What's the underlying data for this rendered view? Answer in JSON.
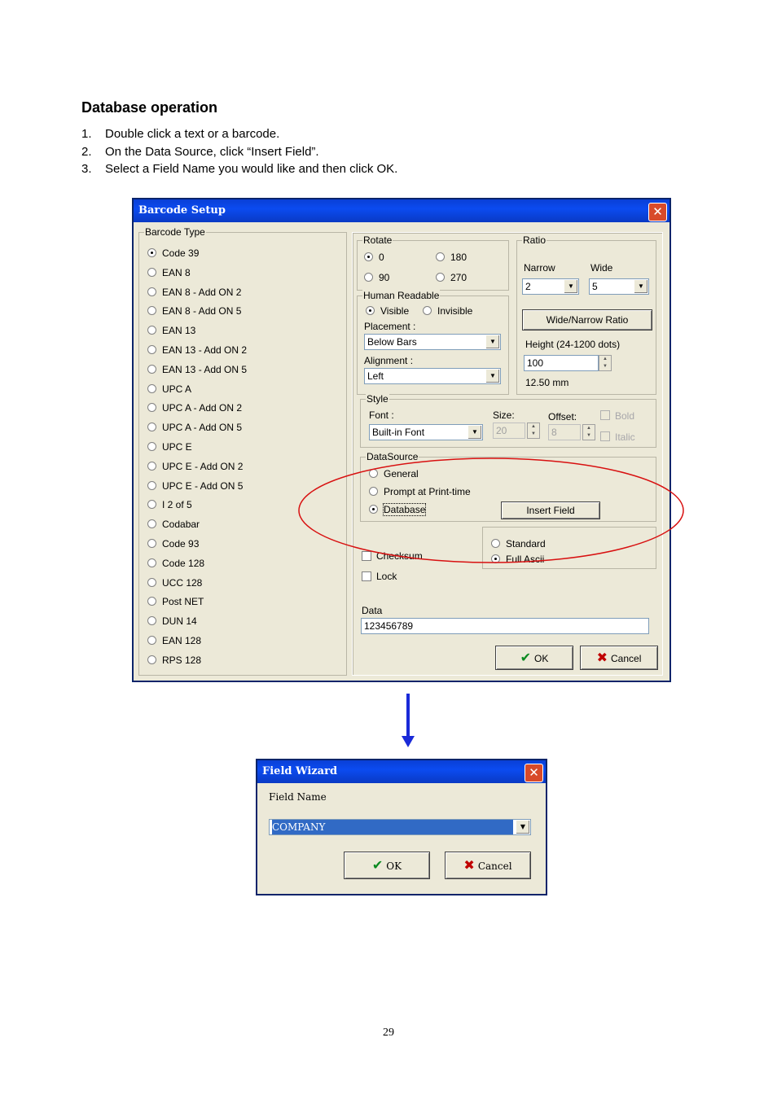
{
  "heading": "Database operation",
  "steps": [
    {
      "num": "1.",
      "text": "Double click a text or a barcode."
    },
    {
      "num": "2.",
      "text": "On the Data Source, click “Insert Field”."
    },
    {
      "num": "3.",
      "text": "Select a Field Name you would like and then click OK."
    }
  ],
  "barcode_setup": {
    "title": "Barcode Setup",
    "barcode_type_label": "Barcode Type",
    "barcode_types": [
      "Code 39",
      "EAN 8",
      "EAN 8 - Add ON 2",
      "EAN 8 - Add ON 5",
      "EAN 13",
      "EAN 13 - Add ON 2",
      "EAN 13 - Add ON 5",
      "UPC A",
      "UPC A - Add ON 2",
      "UPC A - Add ON 5",
      "UPC E",
      "UPC E - Add ON 2",
      "UPC E - Add ON 5",
      "I 2 of 5",
      "Codabar",
      "Code 93",
      "Code 128",
      "UCC 128",
      "Post NET",
      "DUN 14",
      "EAN 128",
      "RPS 128"
    ],
    "selected_type": "Code 39",
    "rotate": {
      "label": "Rotate",
      "options": [
        "0",
        "180",
        "90",
        "270"
      ],
      "selected": "0"
    },
    "ratio": {
      "label": "Ratio",
      "narrow_label": "Narrow",
      "wide_label": "Wide",
      "narrow_value": "2",
      "wide_value": "5",
      "wide_narrow_button": "Wide/Narrow Ratio",
      "height_label": "Height (24-1200 dots)",
      "height_value": "100",
      "height_mm": "12.50 mm"
    },
    "human_readable": {
      "label": "Human Readable",
      "visible": "Visible",
      "invisible": "Invisible",
      "selected": "Visible",
      "placement_label": "Placement :",
      "placement_value": "Below Bars",
      "alignment_label": "Alignment :",
      "alignment_value": "Left"
    },
    "style": {
      "label": "Style",
      "font_label": "Font :",
      "font_value": "Built-in Font",
      "size_label": "Size:",
      "size_value": "20",
      "offset_label": "Offset:",
      "offset_value": "8",
      "bold": "Bold",
      "italic": "Italic"
    },
    "datasource": {
      "label": "DataSource",
      "general": "General",
      "prompt": "Prompt at Print-time",
      "database": "Database",
      "selected": "Database",
      "insert_field": "Insert Field"
    },
    "checksum": "Checksum",
    "mode": {
      "standard": "Standard",
      "full_ascii": "Full Ascii",
      "selected": "Full Ascii"
    },
    "lock": "Lock",
    "data_label": "Data",
    "data_value": "123456789",
    "ok": "OK",
    "cancel": "Cancel",
    "highlight_color": "#d81010"
  },
  "field_wizard": {
    "title": "Field Wizard",
    "field_name_label": "Field Name",
    "field_name_value": "COMPANY",
    "ok": "OK",
    "cancel": "Cancel"
  },
  "arrow_color": "#1a2ad8",
  "page_number": "29"
}
